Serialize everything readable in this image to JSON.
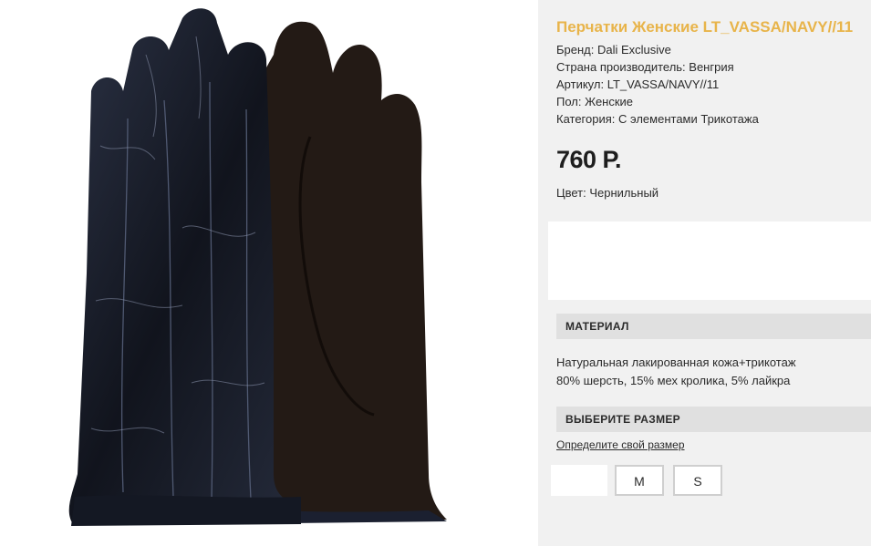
{
  "product": {
    "title": "Перчатки Женские LT_VASSA/NAVY//11",
    "details": [
      "Бренд: Dali Exclusive",
      "Страна производитель: Венгрия",
      "Артикул: LT_VASSA/NAVY//11",
      "Пол: Женские",
      "Категория: С элементами Трикотажа"
    ],
    "price": "760 Р.",
    "color": "Цвет: Чернильный"
  },
  "material": {
    "header": "МАТЕРИАЛ",
    "lines": [
      "Натуральная лакированная кожа+трикотаж",
      "80% шерсть, 15% мех кролика, 5% лайкра"
    ]
  },
  "size": {
    "header": "ВЫБЕРИТЕ РАЗМЕР",
    "link": "Определите свой размер",
    "options": [
      "",
      "M",
      "S"
    ]
  },
  "colors": {
    "title": "#e8b44a",
    "panel_bg": "#f1f1f1",
    "header_bg": "#e0e0e0",
    "glove_patent": "#1b2030",
    "glove_knit": "#231a15"
  },
  "image": {
    "icon": "product-photo-gloves"
  }
}
